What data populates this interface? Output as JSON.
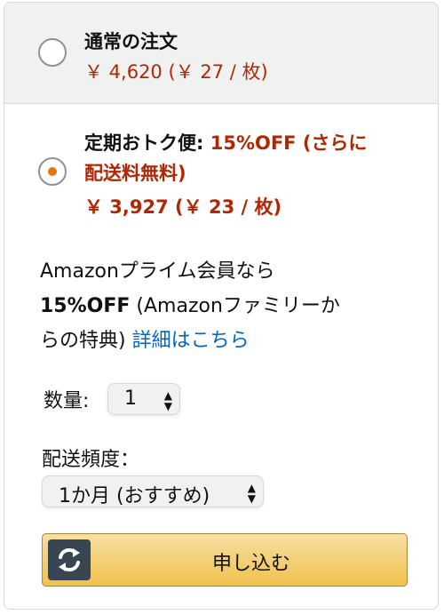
{
  "regular": {
    "title": "通常の注文",
    "price": "￥ 4,620 (￥ 27 / 枚)"
  },
  "subscribe": {
    "title": "定期おトク便:",
    "discount_line1": "15%OFF (さらに",
    "discount_line2": "配送料無料)",
    "price": "￥ 3,927 (￥ 23 / 枚)"
  },
  "prime": {
    "line1": "Amazonプライム会員なら",
    "off": "15%OFF",
    "line2_rest": " (Amazonファミリーか",
    "line3": "らの特典) ",
    "link": "詳細はこちら"
  },
  "quantity": {
    "label": "数量:",
    "value": "1"
  },
  "frequency": {
    "label": "配送頻度：",
    "value": "1か月 (おすすめ)"
  },
  "submit": {
    "label": "申し込む",
    "icon": "refresh-icon"
  },
  "colors": {
    "price": "#b12704",
    "link": "#0066c0",
    "radio_selected": "#e47911",
    "button": "#f0c14b"
  }
}
